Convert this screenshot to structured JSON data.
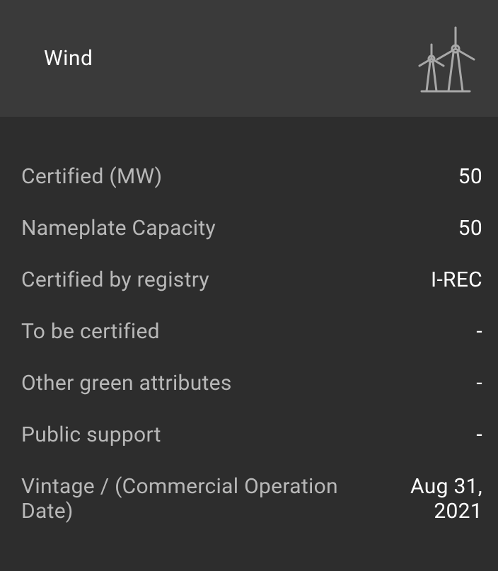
{
  "header": {
    "title": "Wind"
  },
  "details": [
    {
      "label": "Certified (MW)",
      "value": "50"
    },
    {
      "label": "Nameplate Capacity",
      "value": "50"
    },
    {
      "label": "Certified by registry",
      "value": "I-REC"
    },
    {
      "label": "To be certified",
      "value": "-"
    },
    {
      "label": "Other green attributes",
      "value": "-"
    },
    {
      "label": "Public support",
      "value": "-"
    },
    {
      "label": "Vintage / (Commercial Operation Date)",
      "value": "Aug 31, 2021"
    }
  ]
}
